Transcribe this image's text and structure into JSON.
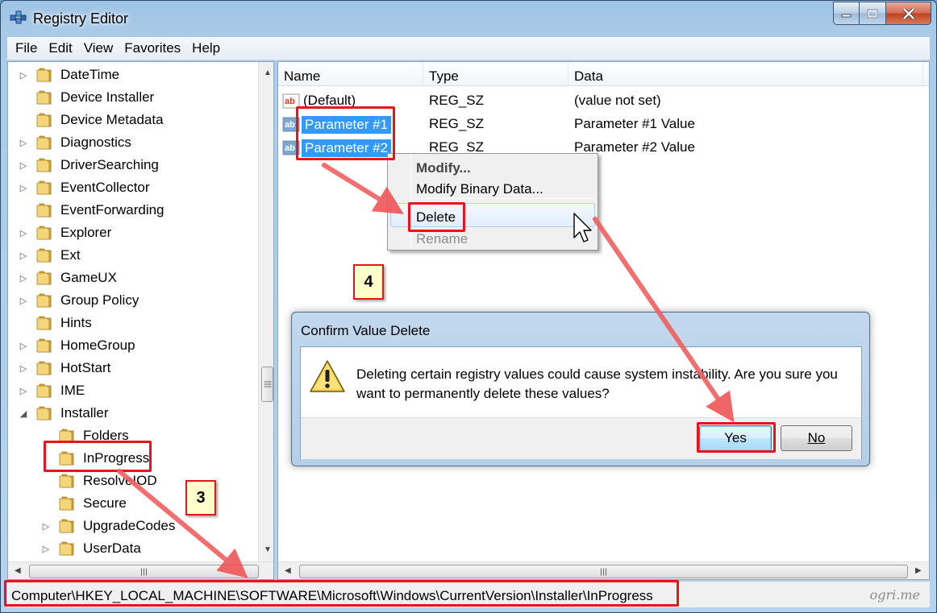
{
  "window": {
    "title": "Registry Editor",
    "icons": {
      "app": "registry-editor-icon",
      "minimize": "minimize-icon",
      "maximize": "maximize-icon",
      "close": "close-icon"
    }
  },
  "menu": [
    "File",
    "Edit",
    "View",
    "Favorites",
    "Help"
  ],
  "tree": {
    "items": [
      {
        "label": "DateTime",
        "expander": "collapsed",
        "indent": 0
      },
      {
        "label": "Device Installer",
        "expander": "none",
        "indent": 0
      },
      {
        "label": "Device Metadata",
        "expander": "none",
        "indent": 0
      },
      {
        "label": "Diagnostics",
        "expander": "collapsed",
        "indent": 0
      },
      {
        "label": "DriverSearching",
        "expander": "collapsed",
        "indent": 0
      },
      {
        "label": "EventCollector",
        "expander": "collapsed",
        "indent": 0
      },
      {
        "label": "EventForwarding",
        "expander": "none",
        "indent": 0
      },
      {
        "label": "Explorer",
        "expander": "collapsed",
        "indent": 0
      },
      {
        "label": "Ext",
        "expander": "collapsed",
        "indent": 0
      },
      {
        "label": "GameUX",
        "expander": "collapsed",
        "indent": 0
      },
      {
        "label": "Group Policy",
        "expander": "collapsed",
        "indent": 0
      },
      {
        "label": "Hints",
        "expander": "none",
        "indent": 0
      },
      {
        "label": "HomeGroup",
        "expander": "collapsed",
        "indent": 0
      },
      {
        "label": "HotStart",
        "expander": "collapsed",
        "indent": 0
      },
      {
        "label": "IME",
        "expander": "collapsed",
        "indent": 0
      },
      {
        "label": "Installer",
        "expander": "expanded",
        "indent": 0
      },
      {
        "label": "Folders",
        "expander": "none",
        "indent": 1
      },
      {
        "label": "InProgress",
        "expander": "none",
        "indent": 1,
        "selected": true
      },
      {
        "label": "ResolveIOD",
        "expander": "none",
        "indent": 1
      },
      {
        "label": "Secure",
        "expander": "none",
        "indent": 1
      },
      {
        "label": "UpgradeCodes",
        "expander": "collapsed",
        "indent": 1
      },
      {
        "label": "UserData",
        "expander": "collapsed",
        "indent": 1
      }
    ]
  },
  "list": {
    "columns": [
      "Name",
      "Type",
      "Data"
    ],
    "rows": [
      {
        "name": "(Default)",
        "type": "REG_SZ",
        "data": "(value not set)",
        "icon": "string-value-icon",
        "selected": false
      },
      {
        "name": "Parameter #1",
        "type": "REG_SZ",
        "data": "Parameter #1 Value",
        "icon": "string-value-icon",
        "selected": true
      },
      {
        "name": "Parameter #2",
        "type": "REG_SZ",
        "data": "Parameter #2 Value",
        "icon": "string-value-icon",
        "selected": true
      }
    ]
  },
  "context_menu": {
    "items": [
      {
        "label": "Modify...",
        "bold": true,
        "disabled": false
      },
      {
        "label": "Modify Binary Data...",
        "bold": false,
        "disabled": false
      },
      {
        "label": "Delete",
        "bold": false,
        "disabled": false,
        "highlighted": true
      },
      {
        "label": "Rename",
        "bold": false,
        "disabled": true
      }
    ]
  },
  "dialog": {
    "title": "Confirm Value Delete",
    "message": "Deleting certain registry values could cause system instability. Are you sure you want to permanently delete these values?",
    "yes_label": "Yes",
    "no_label": "No",
    "icon": "warning-icon"
  },
  "status": {
    "path": "Computer\\HKEY_LOCAL_MACHINE\\SOFTWARE\\Microsoft\\Windows\\CurrentVersion\\Installer\\InProgress"
  },
  "annotations": {
    "step3": "3",
    "step4": "4",
    "color": "#e8141c"
  },
  "watermark": "ogri.me"
}
